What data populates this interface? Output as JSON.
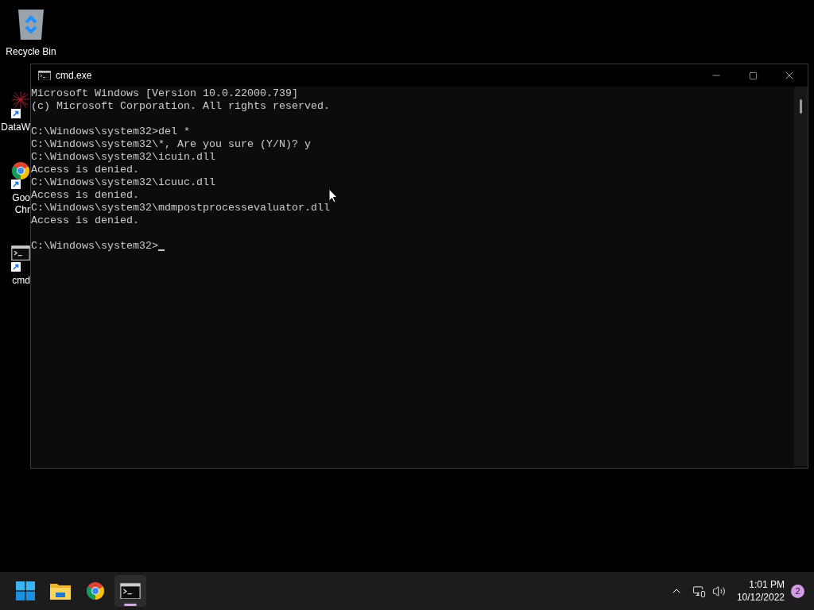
{
  "desktop_icons": [
    {
      "kind": "recycle",
      "label": [
        "Recycle Bin"
      ],
      "shortcut": false
    },
    {
      "kind": "art",
      "label": [
        "DataW"
      ],
      "shortcut": true
    },
    {
      "kind": "chrome",
      "label": [
        "Goo",
        "Chr"
      ],
      "shortcut": true
    },
    {
      "kind": "console",
      "label": [
        "cmd"
      ],
      "shortcut": true
    }
  ],
  "window": {
    "title": "cmd.exe",
    "blocks": [
      [
        "Microsoft Windows [Version 10.0.22000.739]",
        "(c) Microsoft Corporation. All rights reserved."
      ],
      [
        "C:\\Windows\\system32>del *",
        "C:\\Windows\\system32\\*, Are you sure (Y/N)? y",
        "C:\\Windows\\system32\\icuin.dll",
        "Access is denied.",
        "C:\\Windows\\system32\\icuuc.dll",
        "Access is denied.",
        "C:\\Windows\\system32\\mdmpostprocessevaluator.dll",
        "Access is denied."
      ]
    ],
    "prompt": "C:\\Windows\\system32>",
    "cursor": true
  },
  "taskbar": {
    "apps": [
      {
        "kind": "start",
        "selected": false
      },
      {
        "kind": "folder",
        "selected": false
      },
      {
        "kind": "chrome",
        "selected": false
      },
      {
        "kind": "console",
        "selected": true
      }
    ],
    "time": "1:01 PM",
    "date": "10/12/2022",
    "notifications": "2"
  }
}
